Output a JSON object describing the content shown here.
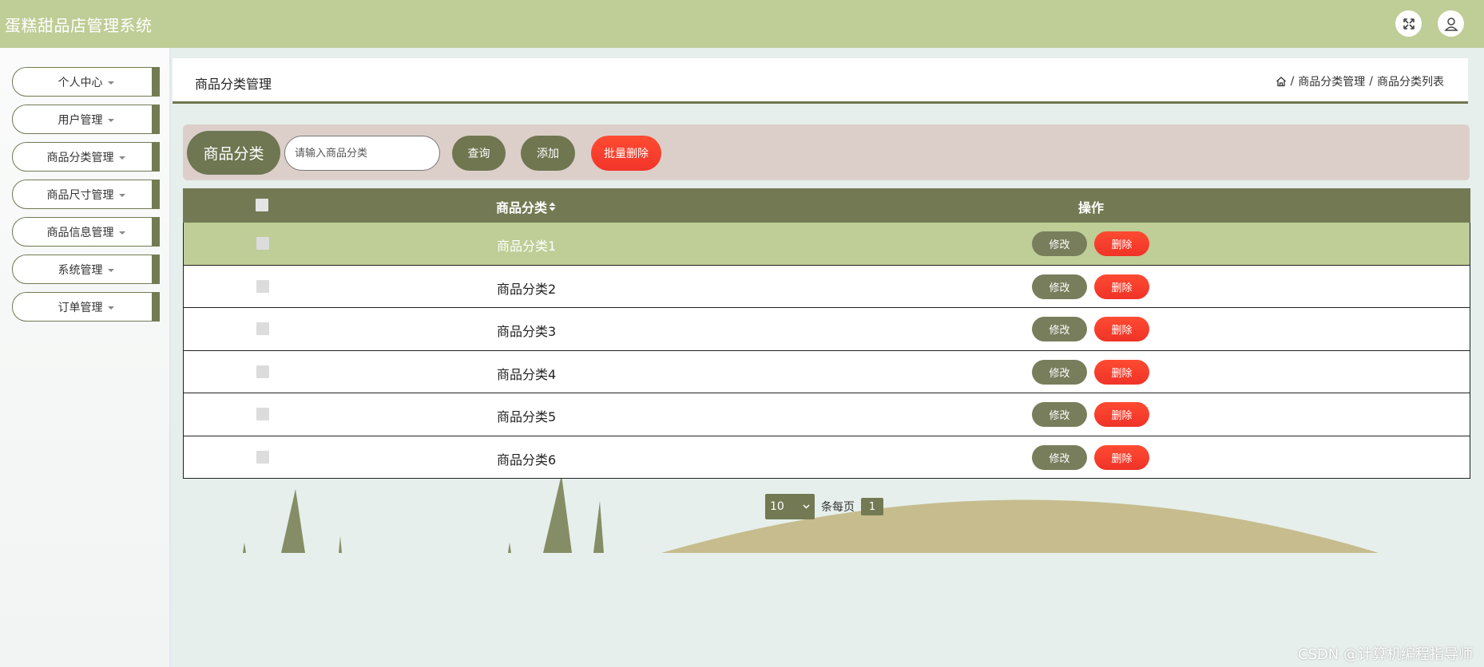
{
  "app": {
    "title": "蛋糕甜品店管理系统"
  },
  "topbar": {
    "icons": [
      "fullscreen-icon",
      "user-icon"
    ]
  },
  "sidebar": {
    "items": [
      {
        "label": "个人中心"
      },
      {
        "label": "用户管理"
      },
      {
        "label": "商品分类管理"
      },
      {
        "label": "商品尺寸管理"
      },
      {
        "label": "商品信息管理"
      },
      {
        "label": "系统管理"
      },
      {
        "label": "订单管理"
      }
    ]
  },
  "header": {
    "title": "商品分类管理",
    "breadcrumb": [
      "商品分类管理",
      "商品分类列表"
    ],
    "separator": "/"
  },
  "search": {
    "label": "商品分类",
    "placeholder": "请输入商品分类",
    "value": "",
    "query_btn": "查询",
    "add_btn": "添加",
    "batch_delete_btn": "批量删除"
  },
  "table": {
    "columns": [
      "商品分类",
      "操作"
    ],
    "sort_icon": "sort-icon",
    "rows": [
      {
        "name": "商品分类1",
        "highlighted": true
      },
      {
        "name": "商品分类2"
      },
      {
        "name": "商品分类3"
      },
      {
        "name": "商品分类4"
      },
      {
        "name": "商品分类5"
      },
      {
        "name": "商品分类6"
      }
    ],
    "edit_label": "修改",
    "delete_label": "删除"
  },
  "pagination": {
    "page_size": "10",
    "per_page_text": "条每页",
    "current_page": "1"
  },
  "watermark": "CSDN @计算机编程指导师",
  "colors": {
    "topbar": "#bfcd96",
    "accent_olive": "#737a53",
    "danger": "#f2352a",
    "search_bg": "#dccfca",
    "highlight_row": "#bfcd96"
  }
}
